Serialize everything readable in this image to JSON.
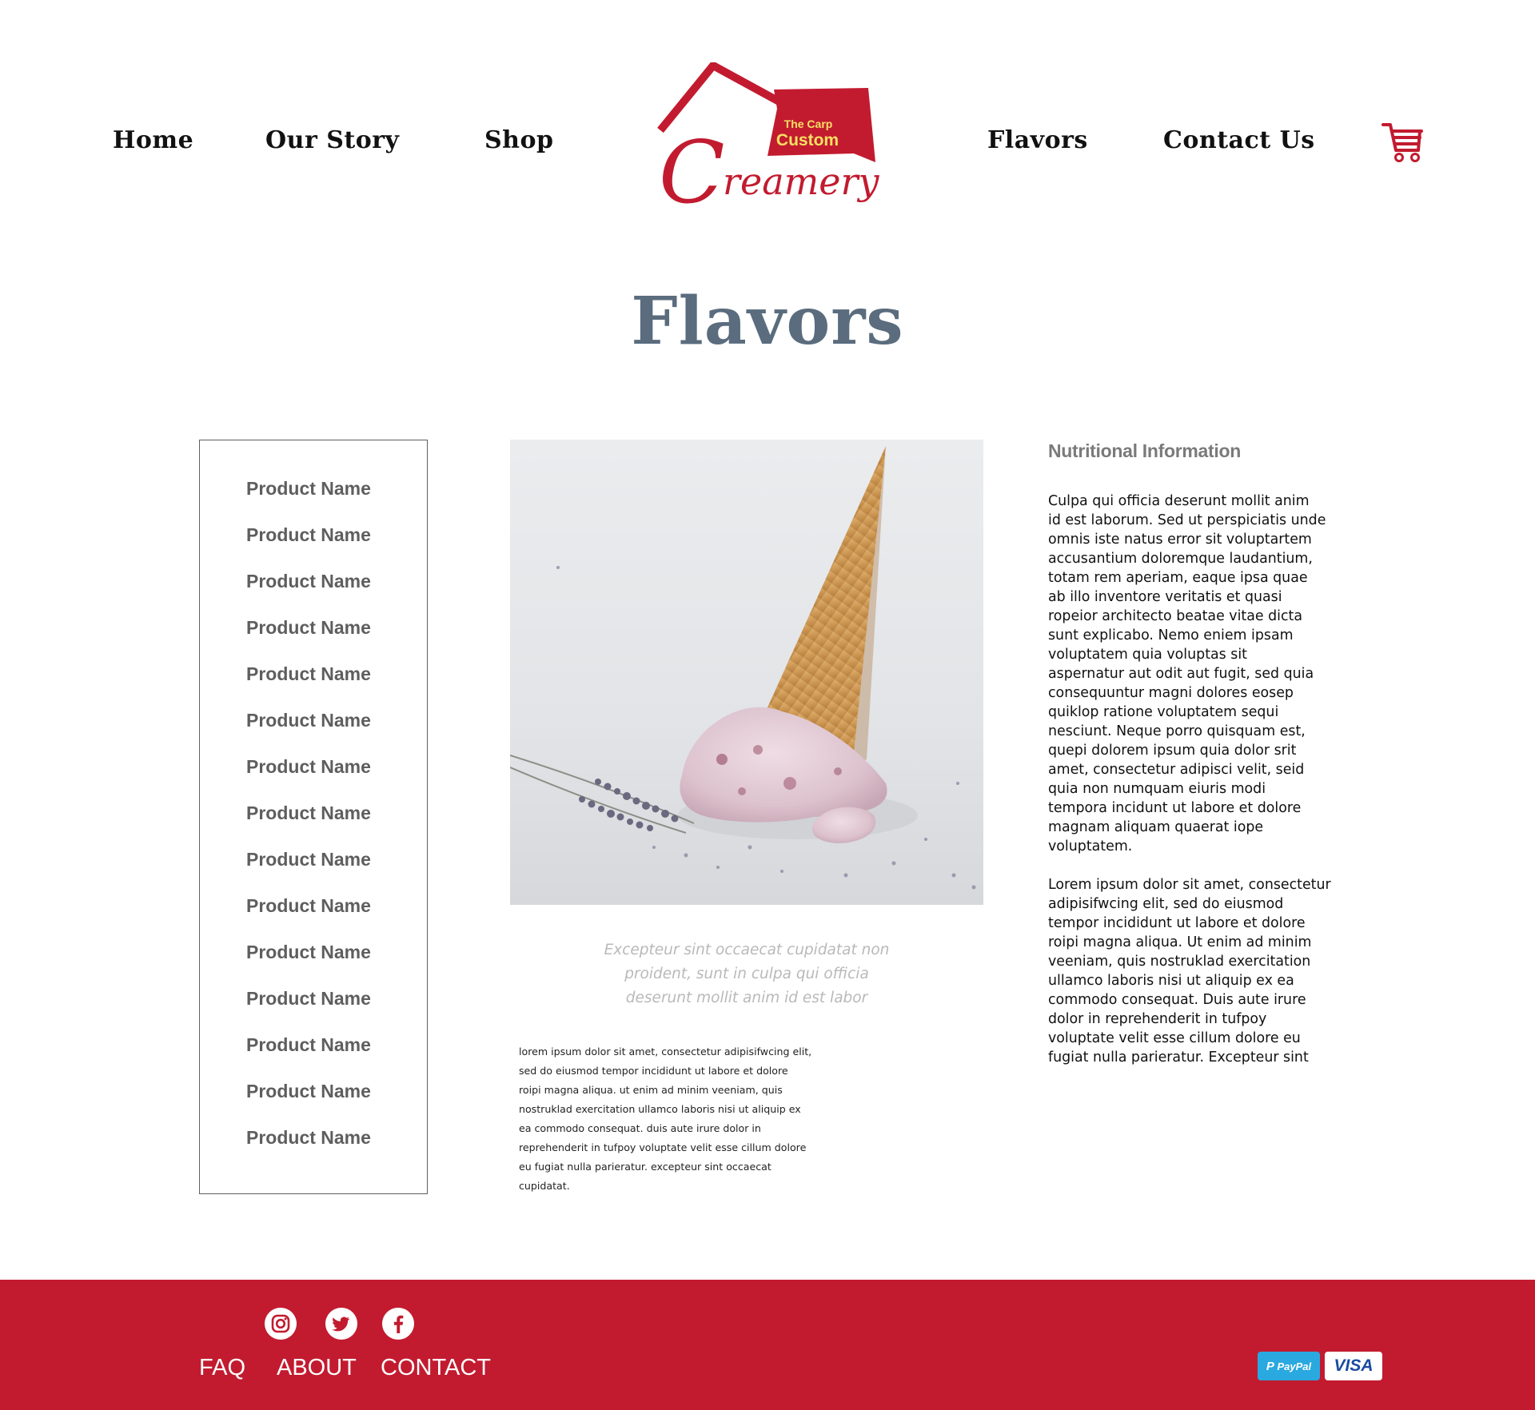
{
  "nav": {
    "left": [
      "Home",
      "Our Story",
      "Shop"
    ],
    "right": [
      "Flavors",
      "Contact Us"
    ]
  },
  "logo": {
    "line1": "The Carp",
    "line2": "Custom",
    "wordmark_initial": "C",
    "wordmark_rest": "reamery"
  },
  "cart": {
    "icon": "shopping-cart-icon"
  },
  "page": {
    "title": "Flavors"
  },
  "products": [
    "Product Name",
    "Product Name",
    "Product Name",
    "Product Name",
    "Product Name",
    "Product Name",
    "Product Name",
    "Product Name",
    "Product Name",
    "Product Name",
    "Product Name",
    "Product Name",
    "Product Name",
    "Product Name",
    "Product Name"
  ],
  "caption": {
    "lines": [
      "Excepteur sint occaecat cupidatat non",
      "proident, sunt in culpa qui officia",
      "deserunt mollit anim id est labor"
    ]
  },
  "body_small": [
    "lorem ipsum dolor sit amet, consectetur adipisifwcing elit,",
    "sed do eiusmod tempor incididunt ut labore et dolore",
    "roipi magna aliqua. ut enim ad minim veeniam, quis",
    "nostruklad exercitation ullamco laboris nisi ut aliquip ex",
    "ea commodo consequat. duis aute irure dolor in",
    "reprehenderit in tufpoy voluptate velit esse cillum dolore",
    "eu fugiat nulla parieratur. excepteur sint occaecat",
    "cupidatat."
  ],
  "nutrition": {
    "heading": "Nutritional Information",
    "p1": [
      "Culpa qui officia deserunt mollit anim",
      "id est laborum. Sed ut perspiciatis unde",
      "omnis iste natus error sit voluptartem",
      "accusantium doloremque laudantium,",
      "totam rem aperiam, eaque ipsa quae",
      "ab illo inventore veritatis et quasi",
      "ropeior architecto beatae vitae dicta",
      "sunt explicabo. Nemo eniem ipsam",
      "voluptatem quia voluptas sit",
      "aspernatur aut odit aut fugit, sed quia",
      "consequuntur magni dolores eosep",
      "quiklop ratione voluptatem sequi",
      "nesciunt. Neque porro quisquam est,",
      "quepi dolorem ipsum quia dolor srit",
      "amet, consectetur adipisci velit, seid",
      "quia non numquam eiuris modi",
      "tempora incidunt ut labore et dolore",
      "magnam aliquam quaerat iope",
      "voluptatem."
    ],
    "p2": [
      "Lorem ipsum dolor sit amet, consectetur",
      "adipisifwcing elit, sed do eiusmod",
      "tempor incididunt ut labore et dolore",
      "roipi magna aliqua. Ut enim ad minim",
      "veeniam, quis nostruklad exercitation",
      "ullamco laboris nisi ut aliquip ex ea",
      "commodo consequat. Duis aute irure",
      "dolor in reprehenderit in tufpoy",
      "voluptate velit esse cillum dolore eu",
      "fugiat nulla parieratur. Excepteur sint"
    ]
  },
  "footer": {
    "social": [
      "instagram-icon",
      "twitter-icon",
      "facebook-icon"
    ],
    "links": [
      "FAQ",
      "ABOUT",
      "CONTACT"
    ],
    "payments": {
      "paypal": "PayPal",
      "visa": "VISA"
    }
  },
  "colors": {
    "brand_red": "#c21b2f",
    "title_slate": "#5a6c7e",
    "product_grey": "#5e5e5e",
    "caption_grey": "#b9b9b9",
    "paypal_blue": "#2aa9e0",
    "visa_blue": "#1a4aa0"
  }
}
